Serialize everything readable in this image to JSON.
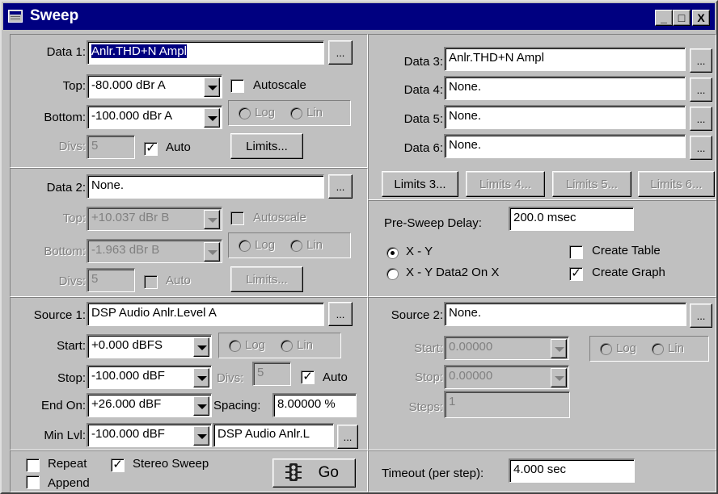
{
  "window": {
    "title": "Sweep",
    "minimize": "_",
    "maximize": "□",
    "close": "X"
  },
  "ellipsis": "...",
  "data1": {
    "label": "Data 1:",
    "value": "Anlr.THD+N Ampl",
    "top_label": "Top:",
    "top_value": "-80.000  dBr A",
    "autoscale": "Autoscale",
    "bottom_label": "Bottom:",
    "bottom_value": "-100.000 dBr A",
    "log": "Log",
    "lin": "Lin",
    "divs_label": "Divs:",
    "divs_value": "5",
    "auto": "Auto",
    "limits": "Limits..."
  },
  "data2": {
    "label": "Data 2:",
    "value": "None.",
    "top_label": "Top:",
    "top_value": "+10.037  dBr B",
    "autoscale": "Autoscale",
    "bottom_label": "Bottom:",
    "bottom_value": "-1.963   dBr B",
    "log": "Log",
    "lin": "Lin",
    "divs_label": "Divs:",
    "divs_value": "5",
    "auto": "Auto",
    "limits": "Limits..."
  },
  "source1": {
    "label": "Source 1:",
    "value": "DSP Audio Anlr.Level A",
    "start_label": "Start:",
    "start_value": "+0.000   dBFS",
    "log": "Log",
    "lin": "Lin",
    "stop_label": "Stop:",
    "stop_value": "-100.000 dBF",
    "divs_label": "Divs:",
    "divs_value": "5",
    "auto": "Auto",
    "endon_label": "End On:",
    "endon_value": "+26.000  dBF",
    "spacing_label": "Spacing:",
    "spacing_value": "8.00000  %",
    "minlvl_label": "Min Lvl:",
    "minlvl_value": "-100.000 dBF",
    "minlvl_source": "DSP Audio Anlr.L"
  },
  "bottom_left": {
    "repeat": "Repeat",
    "stereo_sweep": "Stereo Sweep",
    "append": "Append",
    "go": "Go"
  },
  "right_data": {
    "rows": [
      {
        "label": "Data 3:",
        "value": "Anlr.THD+N Ampl"
      },
      {
        "label": "Data 4:",
        "value": "None."
      },
      {
        "label": "Data 5:",
        "value": "None."
      },
      {
        "label": "Data 6:",
        "value": "None."
      }
    ],
    "limits": [
      "Limits 3...",
      "Limits 4...",
      "Limits 5...",
      "Limits 6..."
    ]
  },
  "presweep": {
    "label": "Pre-Sweep Delay:",
    "value": "200.0    msec",
    "xy": "X - Y",
    "xy_data2": "X - Y  Data2 On X",
    "create_table": "Create Table",
    "create_graph": "Create Graph"
  },
  "source2": {
    "label": "Source 2:",
    "value": "None.",
    "start_label": "Start:",
    "start_value": "0.00000",
    "log": "Log",
    "lin": "Lin",
    "stop_label": "Stop:",
    "stop_value": "0.00000",
    "steps_label": "Steps:",
    "steps_value": "1"
  },
  "timeout": {
    "label": "Timeout (per step):",
    "value": "4.000     sec"
  },
  "colors": {
    "title_bar": "#000080",
    "face": "#c0c0c0",
    "selection": "#000080"
  }
}
